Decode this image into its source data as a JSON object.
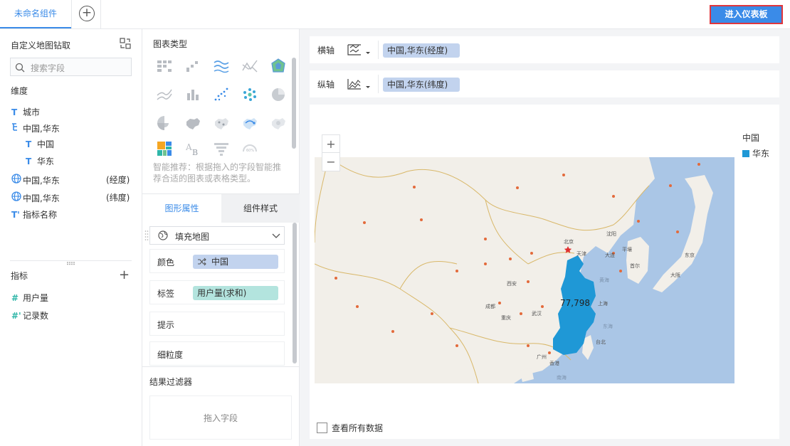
{
  "tabs": {
    "active_label": "未命名组件",
    "add_label": "+"
  },
  "header": {
    "enter_dashboard": "进入仪表板"
  },
  "left": {
    "title": "自定义地图钻取",
    "search_placeholder": "搜索字段",
    "dimension_title": "维度",
    "dimensions": [
      {
        "icon": "T",
        "label": "城市",
        "suffix": ""
      },
      {
        "icon": "tree",
        "label": "中国,华东",
        "suffix": ""
      },
      {
        "icon": "T",
        "label": "中国",
        "suffix": ""
      },
      {
        "icon": "T",
        "label": "华东",
        "suffix": ""
      },
      {
        "icon": "globe",
        "label": "中国,华东",
        "suffix": "(经度)"
      },
      {
        "icon": "globe",
        "label": "中国,华东",
        "suffix": "(纬度)"
      },
      {
        "icon": "T'",
        "label": "指标名称",
        "suffix": ""
      }
    ],
    "measure_title": "指标",
    "measures": [
      {
        "icon": "#",
        "label": "用户量"
      },
      {
        "icon": "#'",
        "label": "记录数"
      }
    ]
  },
  "middle": {
    "chart_type_title": "图表类型",
    "hint": "智能推荐：根据拖入的字段智能推荐合适的图表或表格类型。",
    "tabs": {
      "graph": "图形属性",
      "component": "组件样式"
    },
    "map_type": "填充地图",
    "props": {
      "color": {
        "label": "颜色",
        "pill": "中国"
      },
      "label": {
        "label": "标签",
        "pill": "用户量(求和)"
      },
      "tooltip": {
        "label": "提示"
      },
      "granularity": {
        "label": "细粒度"
      }
    },
    "filter_title": "结果过滤器",
    "filter_drop": "拖入字段"
  },
  "right": {
    "x_axis": {
      "label": "横轴",
      "pill": "中国,华东(经度)"
    },
    "y_axis": {
      "label": "纵轴",
      "pill": "中国,华东(纬度)"
    },
    "legend": {
      "title": "中国",
      "item": "华东",
      "color": "#1f98d6"
    },
    "region_value": "77,798",
    "zoom_in": "+",
    "zoom_out": "−",
    "view_all": "查看所有数据",
    "map_labels": [
      "北京",
      "上海",
      "广州",
      "台北",
      "香港",
      "武汉",
      "成都",
      "重庆",
      "西安",
      "天津",
      "沈阳",
      "大连",
      "首尔",
      "东京",
      "大阪",
      "平壤",
      "黄海",
      "东海",
      "南海"
    ]
  }
}
